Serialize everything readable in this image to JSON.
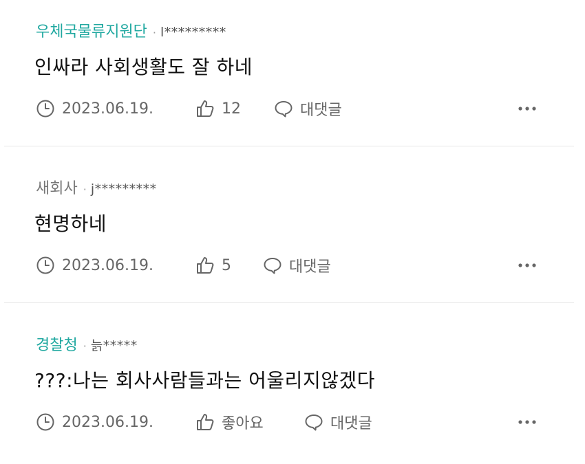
{
  "comments": [
    {
      "author": "우체국물류지원단",
      "separator": "·",
      "user": "l*********",
      "text": "인싸라 사회생활도 잘 하네",
      "date": "2023.06.19.",
      "likes": "12",
      "reply_label": "대댓글",
      "author_color": "#20a8a0"
    },
    {
      "author": "새회사",
      "separator": "·",
      "user": "j*********",
      "text": "현명하네",
      "date": "2023.06.19.",
      "likes": "5",
      "reply_label": "대댓글",
      "author_color": "#777777"
    },
    {
      "author": "경찰청",
      "separator": "·",
      "user": "늙*****",
      "text": "???:나는 회사사람들과는 어울리지않겠다",
      "date": "2023.06.19.",
      "likes": "좋아요",
      "reply_label": "대댓글",
      "author_color": "#20a8a0"
    }
  ],
  "icons": {
    "time": "clock-icon",
    "like": "thumbs-up-icon",
    "reply": "speech-bubble-icon",
    "more": "more-dots-icon"
  }
}
